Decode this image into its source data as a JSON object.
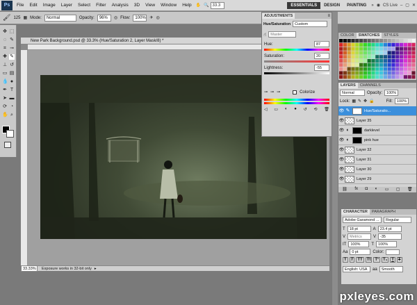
{
  "menubar": {
    "logo": "Ps",
    "items": [
      "File",
      "Edit",
      "Image",
      "Layer",
      "Select",
      "Filter",
      "Analysis",
      "3D",
      "View",
      "Window",
      "Help"
    ],
    "zoom": "33.3",
    "workspaces": [
      "ESSENTIALS",
      "DESIGN",
      "PAINTING"
    ],
    "cs_live": "CS Live"
  },
  "options": {
    "mode_label": "Mode:",
    "mode_value": "Normal",
    "opacity_label": "Opacity:",
    "opacity_value": "96%",
    "flow_label": "Flow:",
    "flow_value": "100%",
    "brush_size": "125"
  },
  "document": {
    "tab_title": "New Park Background.psd @ 33.3% (Hue/Saturation 2, Layer Mask/8) *",
    "status_zoom": "33.33%",
    "status_text": "Exposure works in 32-bit only",
    "ruler_top": [
      "100",
      "150",
      "200",
      "250",
      "300",
      "350",
      "400",
      "450",
      "500",
      "550",
      "600",
      "650",
      "700",
      "750",
      "800",
      "850",
      "900",
      "950",
      "1000"
    ]
  },
  "adjustments": {
    "tab": "ADJUSTMENTS",
    "title": "Hue/Saturation",
    "preset": "Custom",
    "channel": "Master",
    "hue_label": "Hue:",
    "hue_value": "87",
    "saturation_label": "Saturation:",
    "saturation_value": "20",
    "lightness_label": "Lightness:",
    "lightness_value": "-55",
    "colorize_label": "Colorize"
  },
  "swatches": {
    "tabs": [
      "COLOR",
      "SWATCHES",
      "STYLES"
    ]
  },
  "layers": {
    "tabs": [
      "LAYERS",
      "CHANNELS"
    ],
    "blend": "Normal",
    "opacity_label": "Opacity:",
    "opacity_value": "100%",
    "lock_label": "Lock:",
    "fill_label": "Fill:",
    "fill_value": "100%",
    "rows": [
      {
        "name": "Hue/Saturatio...",
        "kind": "adj"
      },
      {
        "name": "Layer 35",
        "kind": "px"
      },
      {
        "name": "darklevel",
        "kind": "adjmask"
      },
      {
        "name": "pink hue",
        "kind": "adjmask"
      },
      {
        "name": "Layer 32",
        "kind": "px"
      },
      {
        "name": "Layer 31",
        "kind": "px"
      },
      {
        "name": "Layer 30",
        "kind": "px"
      },
      {
        "name": "Layer 29",
        "kind": "px"
      }
    ]
  },
  "character": {
    "tabs": [
      "CHARACTER",
      "PARAGRAPH"
    ],
    "font": "Adobe Garamond ...",
    "style": "Regular",
    "size": "18 pt",
    "leading": "23.4 pt",
    "kerning": "Metrics",
    "tracking": "-35",
    "vscale": "100%",
    "hscale": "100%",
    "baseline": "0 pt",
    "color_label": "Color:",
    "language": "English: USA",
    "aa": "aa",
    "aa_method": "Smooth"
  },
  "watermark": "pxleyes.com",
  "colors": {
    "selected_layer": "#3b8fdc",
    "image_dark": "#2c3325",
    "image_light": "#6f7c60"
  }
}
